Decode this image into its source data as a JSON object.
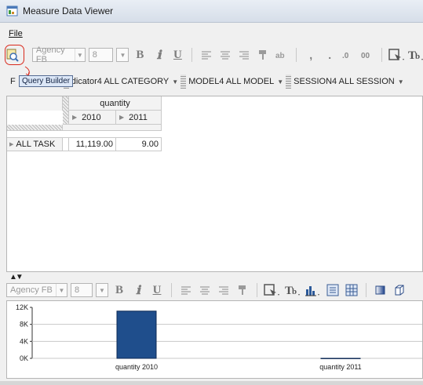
{
  "window": {
    "title": "Measure Data Viewer"
  },
  "menu": {
    "file_label": "File"
  },
  "toolbar_top": {
    "font_name": "Agency FB",
    "font_size": "8",
    "bold": "B",
    "italic": "ℹ",
    "underline": "U"
  },
  "tooltip": {
    "text": "Query Builder"
  },
  "filters": {
    "lead_text": "F",
    "items": [
      {
        "label": "dicator4 ALL CATEGORY"
      },
      {
        "label": "MODEL4 ALL MODEL"
      },
      {
        "label": "SESSION4 ALL SESSION"
      }
    ]
  },
  "pivot": {
    "measure_header": "quantity",
    "years": [
      "2010",
      "2011"
    ],
    "row_label": "ALL TASK",
    "values": [
      "11,119.00",
      "9.00"
    ]
  },
  "toolbar_bottom": {
    "font_name": "Agency FB",
    "font_size": "8",
    "bold": "B",
    "italic": "ℹ",
    "underline": "U"
  },
  "chart_data": {
    "type": "bar",
    "categories": [
      "quantity 2010",
      "quantity 2011"
    ],
    "values": [
      11119,
      9
    ],
    "yticks": [
      "12K",
      "8K",
      "4K",
      "0K"
    ],
    "ylim": [
      0,
      12000
    ],
    "bar_color": "#1f4e8c",
    "grid": false
  },
  "colors": {
    "highlight": "#d9291c",
    "tooltip_bg": "#dce7f7",
    "bar": "#1f4e8c"
  }
}
